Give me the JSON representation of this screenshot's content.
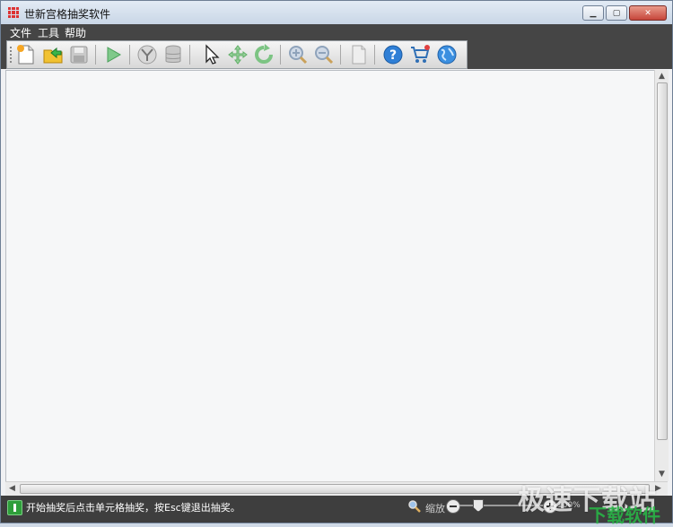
{
  "window": {
    "title": "世新宫格抽奖软件"
  },
  "menu": {
    "items": [
      "文件",
      "工具",
      "帮助"
    ]
  },
  "toolbar": {
    "buttons": [
      {
        "name": "new-file-icon"
      },
      {
        "name": "open-folder-icon"
      },
      {
        "name": "save-icon"
      },
      {
        "name": "play-icon"
      },
      {
        "name": "filter-icon"
      },
      {
        "name": "database-icon"
      },
      {
        "name": "pointer-icon"
      },
      {
        "name": "move-icon"
      },
      {
        "name": "rotate-icon"
      },
      {
        "name": "zoom-in-icon"
      },
      {
        "name": "zoom-out-icon"
      },
      {
        "name": "document-icon"
      },
      {
        "name": "help-icon"
      },
      {
        "name": "cart-icon"
      },
      {
        "name": "globe-icon"
      }
    ]
  },
  "statusbar": {
    "message": "开始抽奖后点击单元格抽奖，按Esc键退出抽奖。",
    "zoom_label": "缩放",
    "zoom_percent": "100%",
    "zoom_level_fraction": 0.2
  },
  "watermark": {
    "line1": "极速下载站",
    "line2": "下载软件"
  }
}
